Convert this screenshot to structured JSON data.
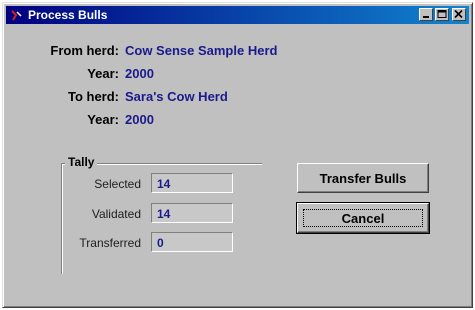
{
  "window": {
    "title": "Process Bulls",
    "controls": {
      "minimize_icon": "minimize-icon",
      "maximize_icon": "maximize-icon",
      "close_icon": "close-icon"
    },
    "titlebar_color": "#000080"
  },
  "info": {
    "from_herd_label": "From herd:",
    "from_herd_value": "Cow Sense Sample Herd",
    "from_year_label": "Year:",
    "from_year_value": "2000",
    "to_herd_label": "To herd:",
    "to_herd_value": "Sara's Cow Herd",
    "to_year_label": "Year:",
    "to_year_value": "2000",
    "value_color": "#1a1a8c"
  },
  "tally": {
    "title": "Tally",
    "selected_label": "Selected",
    "selected_value": "14",
    "validated_label": "Validated",
    "validated_value": "14",
    "transferred_label": "Transferred",
    "transferred_value": "0"
  },
  "buttons": {
    "transfer_label": "Transfer Bulls",
    "cancel_label": "Cancel"
  }
}
